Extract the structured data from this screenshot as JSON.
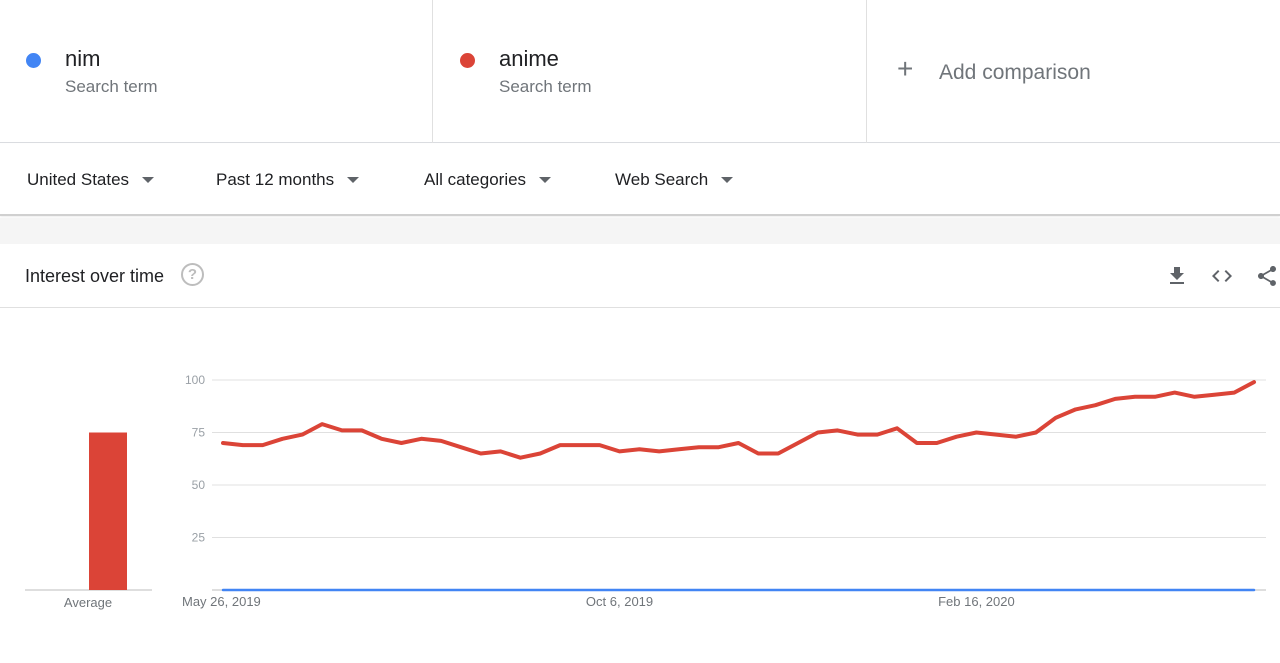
{
  "terms": [
    {
      "name": "nim",
      "sub": "Search term",
      "color": "#4285f4"
    },
    {
      "name": "anime",
      "sub": "Search term",
      "color": "#db4437"
    }
  ],
  "add_comparison": {
    "plus": "+",
    "label": "Add comparison",
    "icon": "plus-icon"
  },
  "filters": [
    {
      "label": "United States"
    },
    {
      "label": "Past 12 months"
    },
    {
      "label": "All categories"
    },
    {
      "label": "Web Search"
    }
  ],
  "card": {
    "title": "Interest over time",
    "help_glyph": "?",
    "icons": [
      "download-icon",
      "embed-icon",
      "share-icon"
    ]
  },
  "chart_data": {
    "type": "line",
    "ylim": [
      0,
      100
    ],
    "yticks": [
      25,
      50,
      75,
      100
    ],
    "grid": true,
    "x_tick_labels": [
      "May 26, 2019",
      "Oct 6, 2019",
      "Feb 16, 2020"
    ],
    "x_tick_indices": [
      0,
      20,
      38
    ],
    "series": [
      {
        "name": "nim",
        "color": "#4285f4",
        "values": [
          0,
          0,
          0,
          0,
          0,
          0,
          0,
          0,
          0,
          0,
          0,
          0,
          0,
          0,
          0,
          0,
          0,
          0,
          0,
          0,
          0,
          0,
          0,
          0,
          0,
          0,
          0,
          0,
          0,
          0,
          0,
          0,
          0,
          0,
          0,
          0,
          0,
          0,
          0,
          0,
          0,
          0,
          0,
          0,
          0,
          0,
          0,
          0,
          0,
          0,
          0,
          0,
          0
        ]
      },
      {
        "name": "anime",
        "color": "#db4437",
        "values": [
          70,
          69,
          69,
          72,
          74,
          79,
          76,
          76,
          72,
          70,
          72,
          71,
          68,
          65,
          66,
          63,
          65,
          69,
          69,
          69,
          66,
          67,
          66,
          67,
          68,
          68,
          70,
          65,
          65,
          70,
          75,
          76,
          74,
          74,
          77,
          70,
          70,
          73,
          75,
          74,
          73,
          75,
          82,
          86,
          88,
          91,
          92,
          92,
          94,
          92,
          93,
          94,
          99
        ]
      }
    ],
    "average": {
      "label": "Average",
      "values": [
        0,
        75
      ]
    }
  }
}
